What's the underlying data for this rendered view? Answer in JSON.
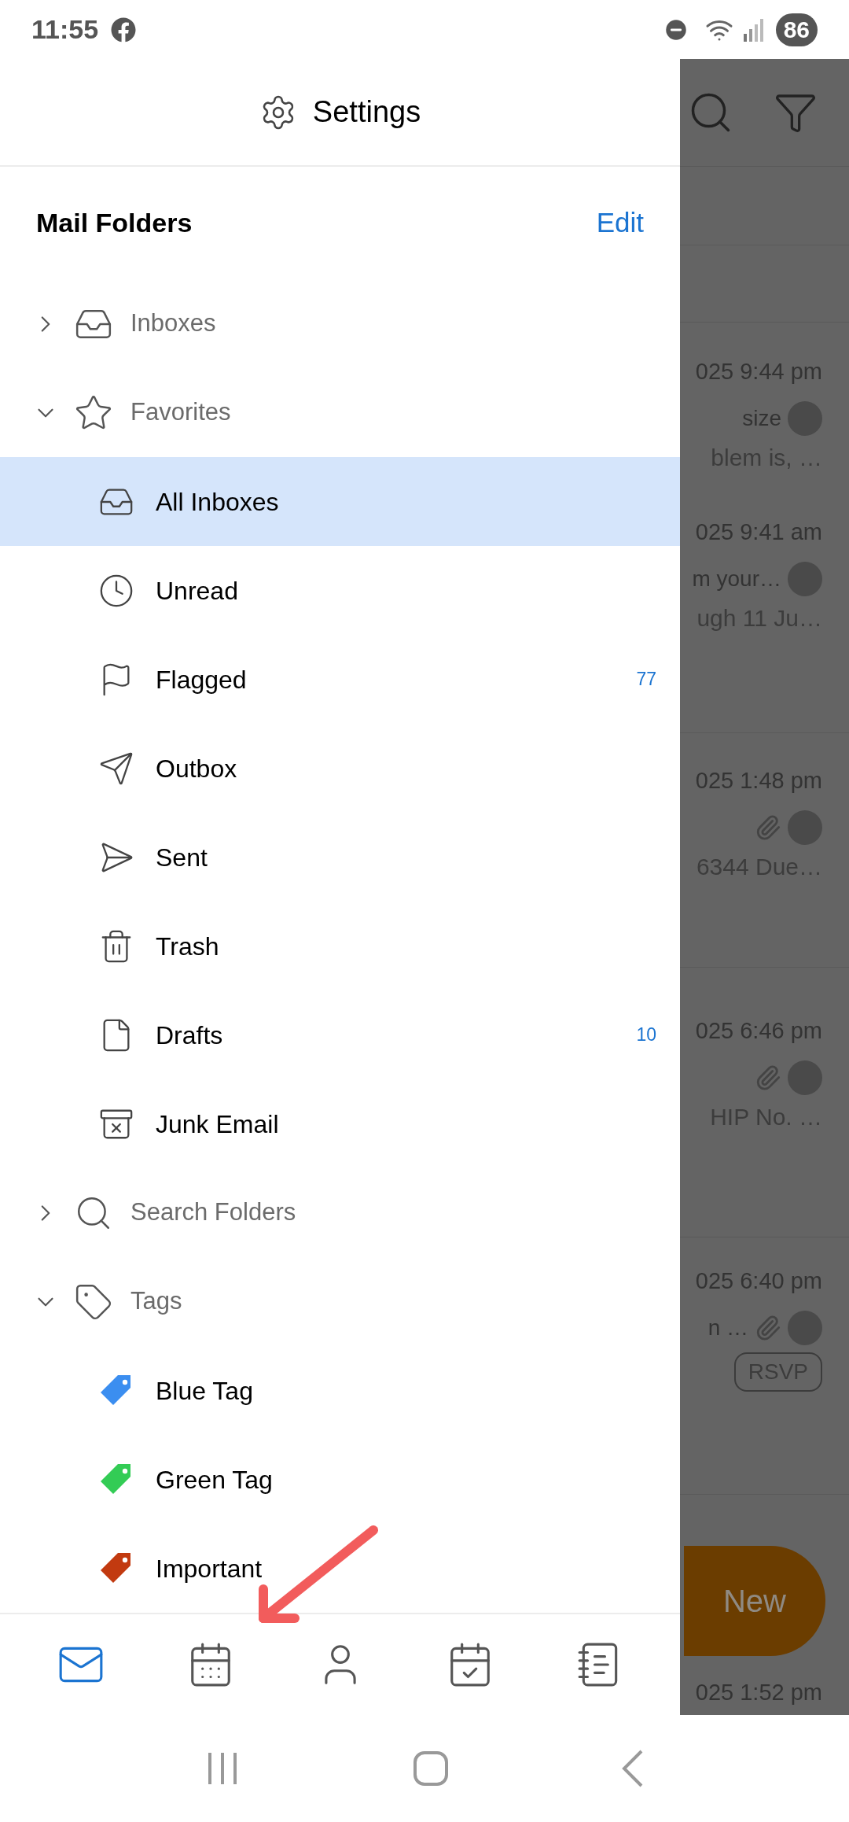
{
  "status_bar": {
    "time": "11:55",
    "battery": "86"
  },
  "header": {
    "title": "Settings"
  },
  "section": {
    "title": "Mail Folders",
    "action": "Edit"
  },
  "groups": [
    {
      "label": "Inboxes",
      "expanded": false
    },
    {
      "label": "Favorites",
      "expanded": true,
      "children": [
        {
          "label": "All Inboxes",
          "selected": true
        },
        {
          "label": "Unread",
          "selected": false
        },
        {
          "label": "Flagged",
          "selected": false,
          "count": "77"
        },
        {
          "label": "Outbox",
          "selected": false
        },
        {
          "label": "Sent",
          "selected": false
        },
        {
          "label": "Trash",
          "selected": false
        },
        {
          "label": "Drafts",
          "selected": false,
          "count": "10"
        },
        {
          "label": "Junk Email",
          "selected": false
        }
      ]
    },
    {
      "label": "Search Folders",
      "expanded": false
    },
    {
      "label": "Tags",
      "expanded": true,
      "children": [
        {
          "label": "Blue Tag",
          "selected": false,
          "color": "#3b8ef0"
        },
        {
          "label": "Green Tag",
          "selected": false,
          "color": "#33cc55"
        },
        {
          "label": "Important",
          "selected": false,
          "color": "#c23a10"
        }
      ]
    }
  ],
  "bottom_tabs": [
    {
      "selected": true
    },
    {
      "selected": false
    },
    {
      "selected": false
    },
    {
      "selected": false
    },
    {
      "selected": false
    }
  ],
  "background_list": {
    "emails": [
      {
        "time": "025 9:44 pm",
        "subject": "size",
        "preview": "blem is, …",
        "attachment": false
      },
      {
        "time": "025 9:41 am",
        "subject": "m your…",
        "preview": "ugh 11 Ju…",
        "attachment": false
      },
      {
        "time": "025 1:48 pm",
        "preview": "6344 Due…",
        "attachment": true
      },
      {
        "time": "025 6:46 pm",
        "preview": "HIP No. …",
        "attachment": true
      },
      {
        "time": "025 6:40 pm",
        "subject": "n …",
        "attachment": true,
        "badge": "RSVP"
      },
      {
        "time": "025 1:52 pm",
        "attachment": false
      }
    ],
    "new_button": "New"
  }
}
